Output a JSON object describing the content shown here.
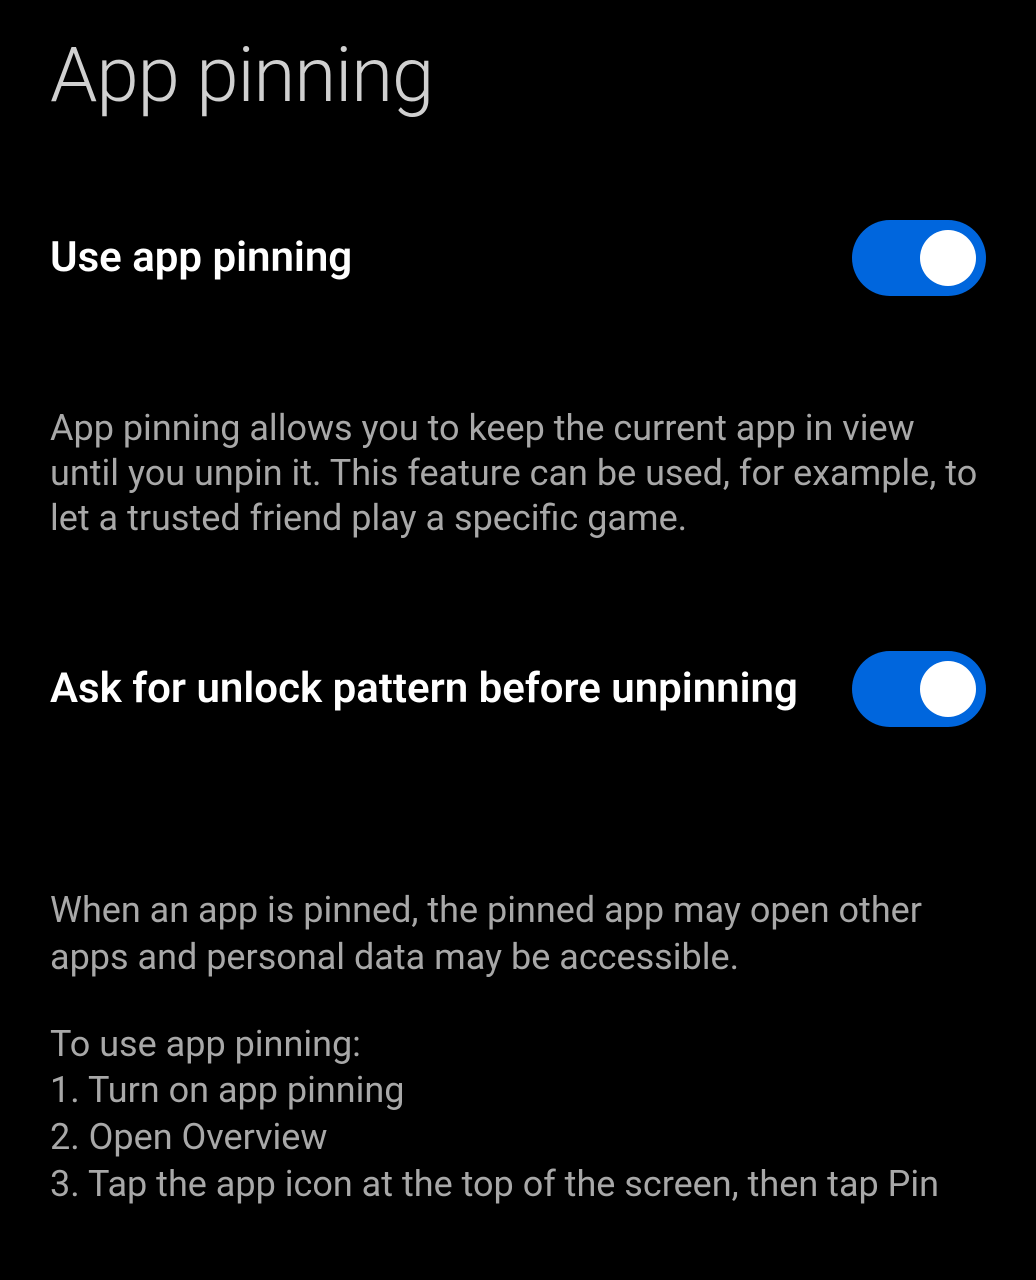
{
  "page": {
    "title": "App pinning"
  },
  "settings": {
    "use_app_pinning": {
      "label": "Use app pinning",
      "enabled": true,
      "description": "App pinning allows you to keep the current app in view until you unpin it. This feature can be used, for example, to let a trusted friend play a specific game."
    },
    "ask_unlock_pattern": {
      "label": "Ask for unlock pattern before unpinning",
      "enabled": true
    }
  },
  "info": {
    "warning": "When an app is pinned, the pinned app may open other apps and personal data may be accessible.",
    "instructions_header": "To use app pinning:",
    "instructions": [
      "1. Turn on app pinning",
      "2. Open Overview",
      "3. Tap the app icon at the top of the screen, then tap Pin"
    ]
  },
  "colors": {
    "toggle_on": "#0066dd",
    "background": "#000000",
    "text_primary": "#ffffff",
    "text_secondary": "#a8a8a8"
  }
}
